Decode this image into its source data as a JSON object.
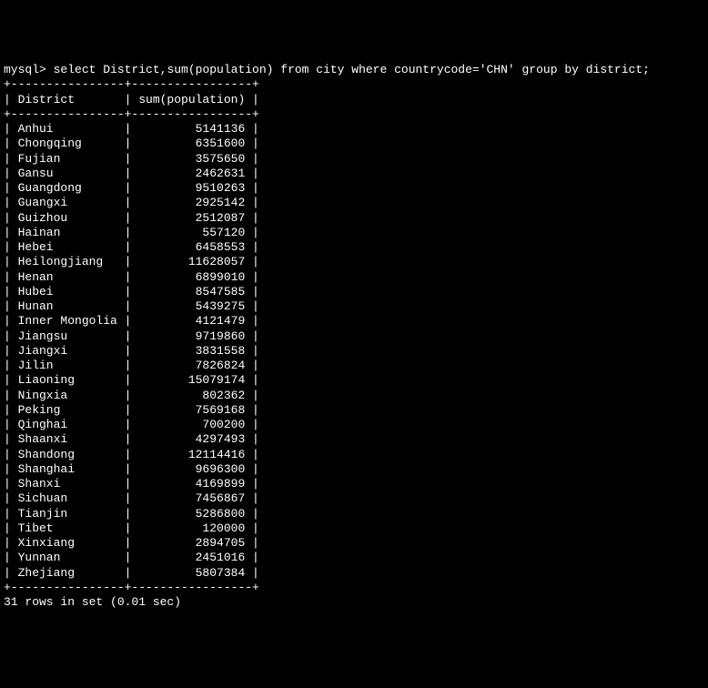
{
  "prompt": "mysql>",
  "query": "select District,sum(population) from city where countrycode='CHN' group by district;",
  "columns": [
    "District",
    "sum(population)"
  ],
  "col1_width": 16,
  "col2_width": 17,
  "rows": [
    {
      "district": "Anhui",
      "sum": 5141136
    },
    {
      "district": "Chongqing",
      "sum": 6351600
    },
    {
      "district": "Fujian",
      "sum": 3575650
    },
    {
      "district": "Gansu",
      "sum": 2462631
    },
    {
      "district": "Guangdong",
      "sum": 9510263
    },
    {
      "district": "Guangxi",
      "sum": 2925142
    },
    {
      "district": "Guizhou",
      "sum": 2512087
    },
    {
      "district": "Hainan",
      "sum": 557120
    },
    {
      "district": "Hebei",
      "sum": 6458553
    },
    {
      "district": "Heilongjiang",
      "sum": 11628057
    },
    {
      "district": "Henan",
      "sum": 6899010
    },
    {
      "district": "Hubei",
      "sum": 8547585
    },
    {
      "district": "Hunan",
      "sum": 5439275
    },
    {
      "district": "Inner Mongolia",
      "sum": 4121479
    },
    {
      "district": "Jiangsu",
      "sum": 9719860
    },
    {
      "district": "Jiangxi",
      "sum": 3831558
    },
    {
      "district": "Jilin",
      "sum": 7826824
    },
    {
      "district": "Liaoning",
      "sum": 15079174
    },
    {
      "district": "Ningxia",
      "sum": 802362
    },
    {
      "district": "Peking",
      "sum": 7569168
    },
    {
      "district": "Qinghai",
      "sum": 700200
    },
    {
      "district": "Shaanxi",
      "sum": 4297493
    },
    {
      "district": "Shandong",
      "sum": 12114416
    },
    {
      "district": "Shanghai",
      "sum": 9696300
    },
    {
      "district": "Shanxi",
      "sum": 4169899
    },
    {
      "district": "Sichuan",
      "sum": 7456867
    },
    {
      "district": "Tianjin",
      "sum": 5286800
    },
    {
      "district": "Tibet",
      "sum": 120000
    },
    {
      "district": "Xinxiang",
      "sum": 2894705
    },
    {
      "district": "Yunnan",
      "sum": 2451016
    },
    {
      "district": "Zhejiang",
      "sum": 5807384
    }
  ],
  "status": "31 rows in set (0.01 sec)"
}
